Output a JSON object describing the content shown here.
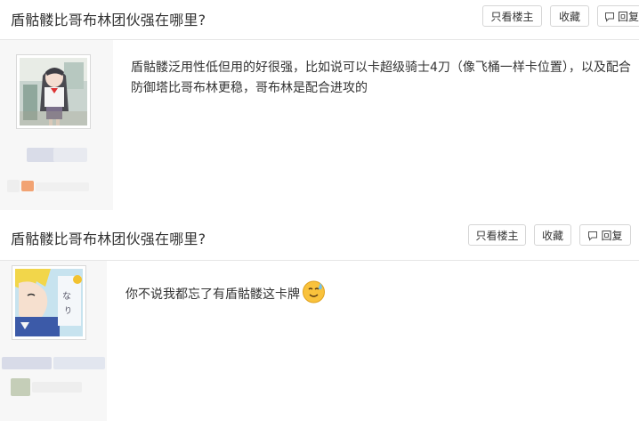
{
  "thread": {
    "title": "盾骷髅比哥布林团伙强在哪里?"
  },
  "toolbar": {
    "only_op_label": "只看楼主",
    "favorite_label": "收藏",
    "reply_label": "回复",
    "reply_label_truncated": "回复"
  },
  "posts": [
    {
      "lines": [
        "盾骷髅泛用性低但用的好很强，比如说可以卡超级骑士4刀（像飞桶一样卡位置），以及配合",
        "防御塔比哥布林更稳，哥布林是配合进攻的"
      ]
    },
    {
      "text": "你不说我都忘了有盾骷髅这卡牌",
      "emoji_icon": "sweat-smile-emoji-icon"
    }
  ],
  "colors": {
    "header_border": "#e6e6e6",
    "author_bg": "#f7f7f7",
    "button_border": "#d6d6d6",
    "text": "#333333"
  }
}
